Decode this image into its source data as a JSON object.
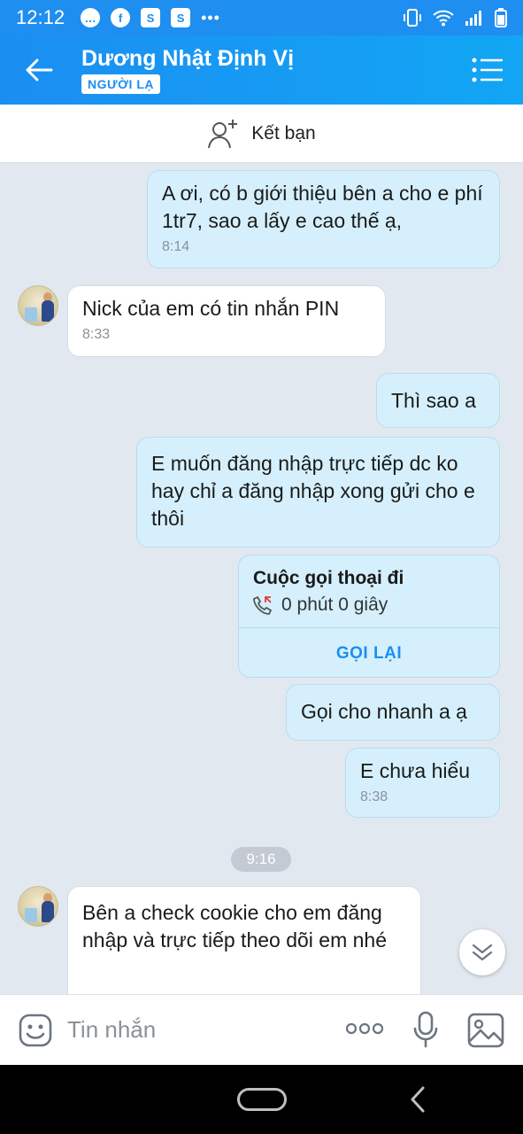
{
  "status_bar": {
    "time": "12:12"
  },
  "header": {
    "contact_name": "Dương Nhật Định Vị",
    "badge": "NGƯỜI LẠ"
  },
  "friend_bar": {
    "label": "Kết bạn"
  },
  "messages": [
    {
      "direction": "out",
      "text": "A ơi, có b giới thiệu bên a cho e phí 1tr7, sao a lấy e cao thế ạ,",
      "time": "8:14"
    },
    {
      "direction": "in",
      "text": "Nick của em có tin nhắn PIN",
      "time": "8:33"
    },
    {
      "direction": "out",
      "text": "Thì sao a",
      "time": ""
    },
    {
      "direction": "out",
      "text": "E muốn đăng nhập trực tiếp dc ko hay chỉ a đăng nhập xong gửi cho e thôi",
      "time": ""
    },
    {
      "direction": "out",
      "text": "Gọi cho nhanh a ạ",
      "time": ""
    },
    {
      "direction": "out",
      "text": "E chưa hiểu",
      "time": "8:38"
    },
    {
      "direction": "in",
      "text": "Bên a check cookie cho em đăng nhập và trực tiếp theo dõi em nhé",
      "time": ""
    }
  ],
  "call_card": {
    "title": "Cuộc gọi thoại đi",
    "duration": "0 phút 0 giây",
    "action": "GỌI LẠI"
  },
  "time_separator": "9:16",
  "input_bar": {
    "placeholder": "Tin nhắn"
  },
  "colors": {
    "header_blue": "#1b8ef2",
    "outgoing_bubble": "#d5f0fc",
    "incoming_bubble": "#ffffff",
    "chat_background": "#e2e8ef"
  },
  "icons": [
    "back-arrow-icon",
    "menu-icon",
    "add-friend-icon",
    "missed-call-icon",
    "chevron-down-icon",
    "emoji-icon",
    "more-dots-icon",
    "microphone-icon",
    "image-icon"
  ]
}
